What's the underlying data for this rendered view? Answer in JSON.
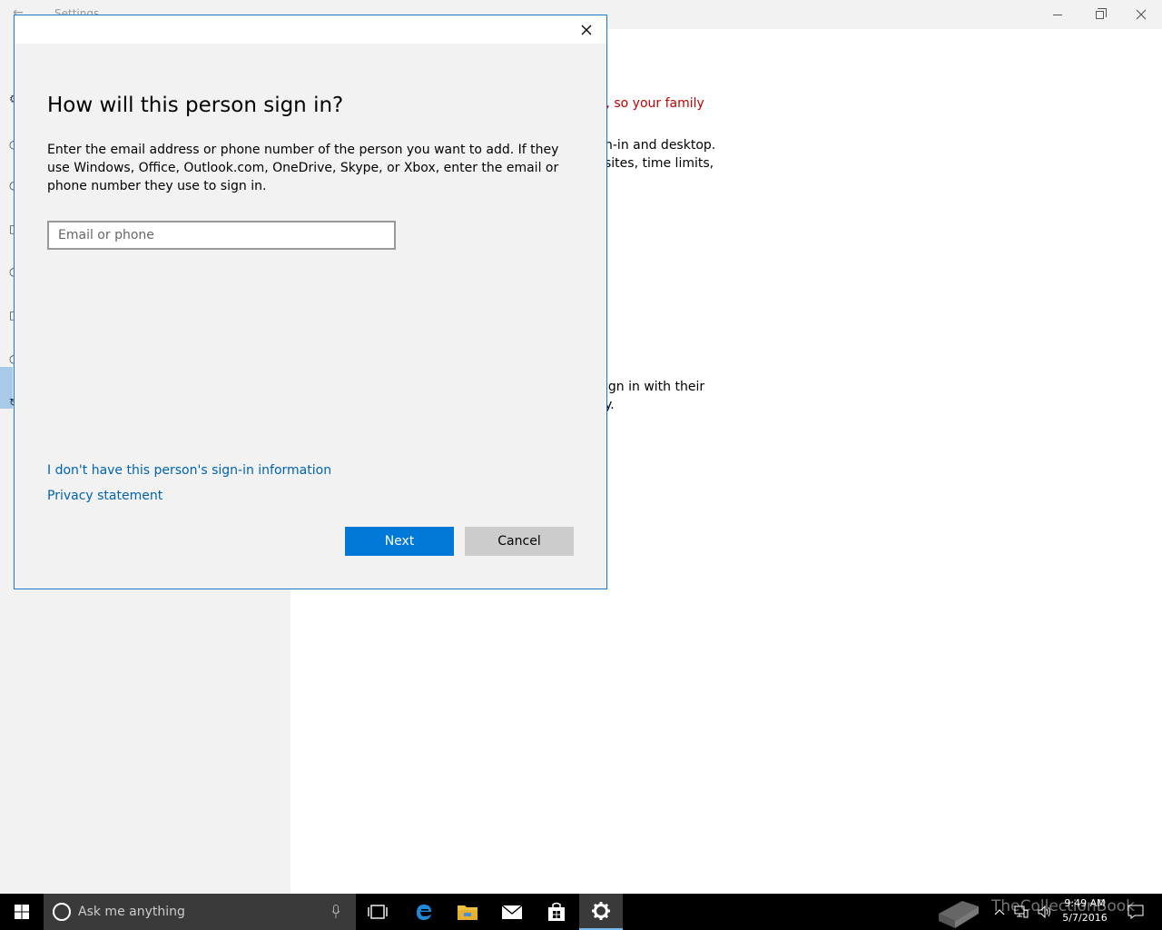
{
  "settings_window": {
    "title": "Settings",
    "content_fragments": {
      "red_line": "w, so your family",
      "line1": "n-in and desktop.",
      "line2": "sites, time limits,",
      "line3": "ign in with their",
      "line4": "y."
    }
  },
  "dialog": {
    "heading": "How will this person sign in?",
    "description": "Enter the email address or phone number of the person you want to add. If they use Windows, Office, Outlook.com, OneDrive, Skype, or Xbox, enter the email or phone number they use to sign in.",
    "input": {
      "value": "",
      "placeholder": "Email or phone"
    },
    "link_no_info": "I don't have this person's sign-in information",
    "link_privacy": "Privacy statement",
    "next_label": "Next",
    "cancel_label": "Cancel"
  },
  "taskbar": {
    "search_placeholder": "Ask me anything",
    "clock_time": "9:49 AM",
    "clock_date": "5/7/2016"
  },
  "watermark": {
    "text": "TheCollectionBook"
  },
  "colors": {
    "accent": "#0078d7",
    "link": "#0063b1",
    "dialog_border": "#1979ca",
    "warning_red": "#c00000",
    "taskbar": "#000000"
  },
  "icons": [
    "close-icon",
    "back-arrow-icon",
    "minimize-icon",
    "maximize-icon",
    "windows-logo-icon",
    "cortana-icon",
    "microphone-icon",
    "task-view-icon",
    "edge-icon",
    "file-explorer-icon",
    "mail-icon",
    "store-icon",
    "settings-gear-icon",
    "chevron-up-icon",
    "network-icon",
    "volume-icon",
    "action-center-icon",
    "book-icon"
  ]
}
